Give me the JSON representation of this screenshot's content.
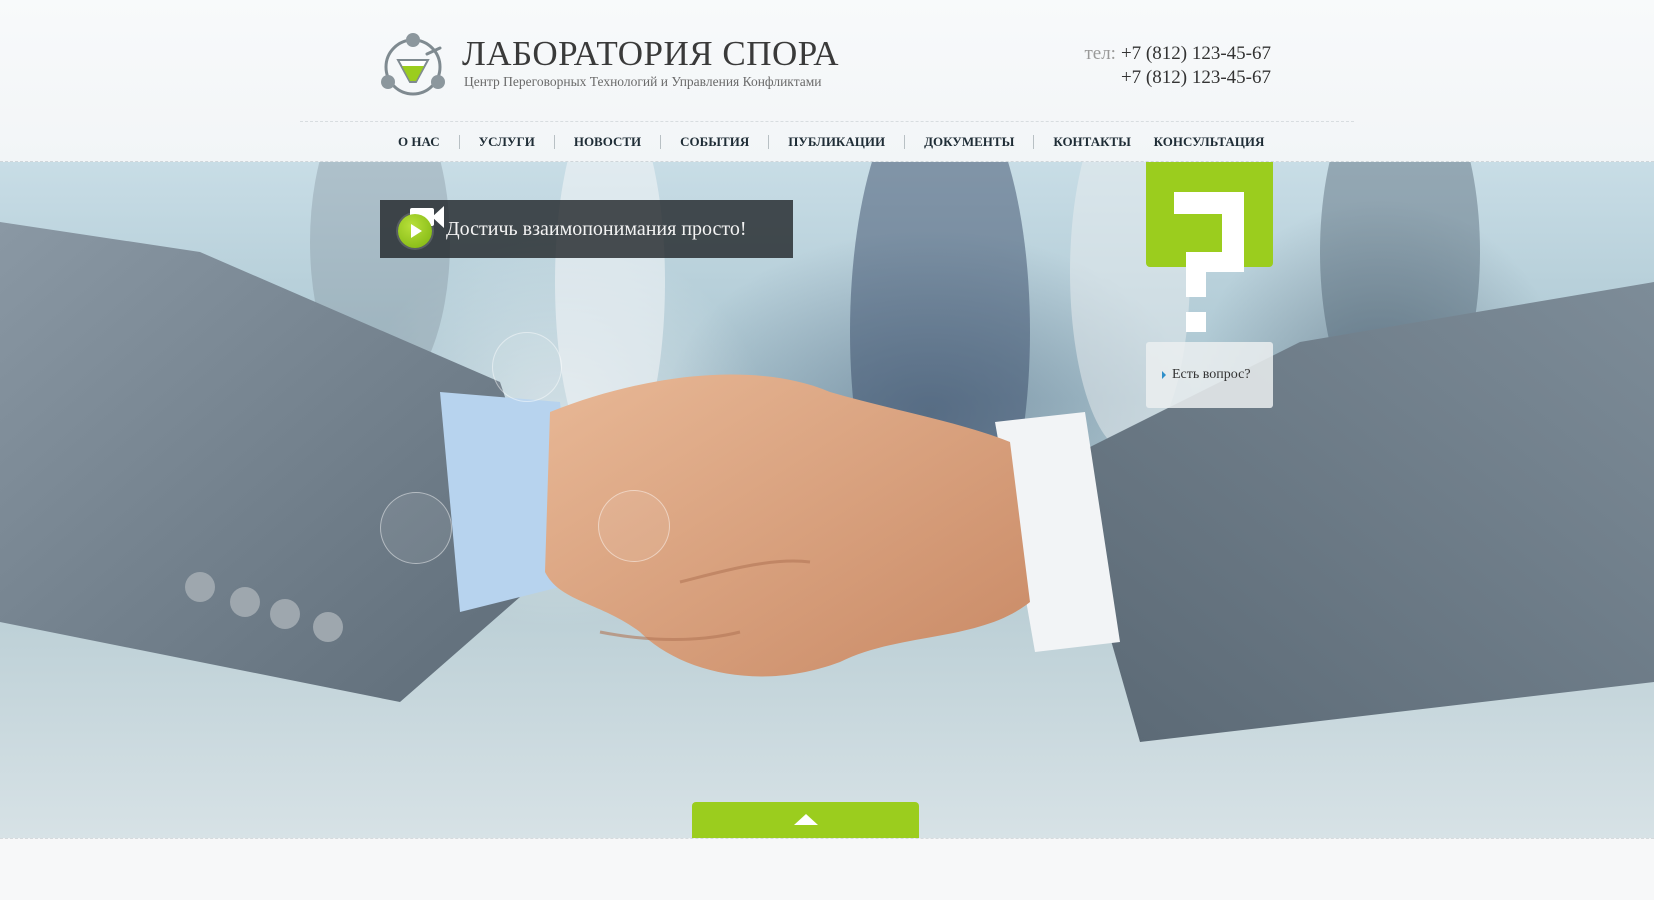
{
  "brand": {
    "title": "ЛАБОРАТОРИЯ СПОРА",
    "subtitle": "Центр Переговорных Технологий и Управления Конфликтами",
    "logo_icon": "flask-logo-icon"
  },
  "contacts": {
    "phone_label": "тел:",
    "phone_1": "+7 (812) 123-45-67",
    "phone_2": "+7 (812) 123-45-67"
  },
  "nav": {
    "items": [
      {
        "label": "О НАС"
      },
      {
        "label": "УСЛУГИ"
      },
      {
        "label": "НОВОСТИ"
      },
      {
        "label": "СОБЫТИЯ"
      },
      {
        "label": "ПУБЛИКАЦИИ"
      },
      {
        "label": "ДОКУМЕНТЫ"
      },
      {
        "label": "КОНТАКТЫ"
      }
    ],
    "consult_label": "КОНСУЛЬТАЦИЯ"
  },
  "hero": {
    "video_text": "Достичь взаимопонимания просто!",
    "video_icon": "video-camera-play-icon",
    "question_icon": "question-mark-icon",
    "question_label": "Есть вопрос?"
  },
  "footer": {
    "scroll_icon": "arrow-up-icon"
  },
  "colors": {
    "accent_green": "#9bcd1e",
    "nav_text": "#1f2d36",
    "banner_bg": "#23282c"
  }
}
